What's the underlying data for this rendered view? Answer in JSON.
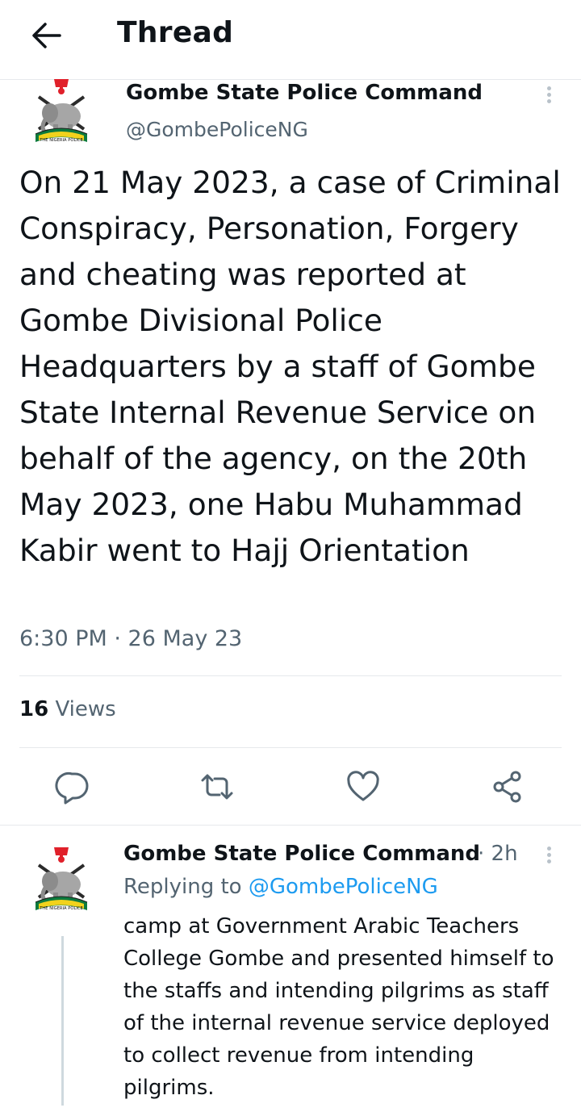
{
  "header": {
    "title": "Thread"
  },
  "tweet": {
    "author_name": "Gombe State Police Command",
    "author_handle": "@GombePoliceNG",
    "text": "On 21 May 2023, a case of Criminal Conspiracy, Personation, Forgery and cheating was reported at Gombe Divisional Police Headquarters by a staff of Gombe State Internal Revenue Service on behalf of the agency, on the 20th May 2023, one Habu Muhammad Kabir went to Hajj Orientation",
    "timestamp": "6:30 PM · 26 May 23",
    "views_count": "16",
    "views_label": " Views",
    "logo_text": "THE NIGERIA POLICE"
  },
  "actions": [
    "reply-icon",
    "retweet-icon",
    "like-icon",
    "share-icon"
  ],
  "reply": {
    "author_name": "Gombe State Police Command",
    "time": "· 2h",
    "replying_prefix": "Replying to ",
    "replying_handle": "@GombePoliceNG",
    "text": "camp at Government Arabic Teachers College Gombe and presented himself to the staffs and intending pilgrims as staff of the internal revenue service deployed to collect revenue from intending pilgrims."
  },
  "colors": {
    "text": "#0f1419",
    "secondary": "#536471",
    "accent": "#1d9bf0",
    "divider": "#e6e9ec"
  }
}
